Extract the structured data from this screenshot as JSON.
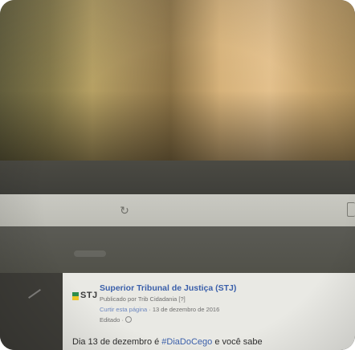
{
  "post": {
    "logo_text": "STJ",
    "page_name": "Superior Tribunal de Justiça (STJ)",
    "published_by": "Publicado por Trib Cidadania [?]",
    "like_link": "Curtir esta página",
    "date": " · 13 de dezembro de 2016",
    "edited": "Editado ·",
    "body_prefix": "Dia 13 de dezembro é ",
    "hashtag": "#DiaDoCego",
    "body_suffix": " e você sabe"
  },
  "icons": {
    "reload": "reload-icon",
    "share": "share-icon",
    "globe": "globe-icon"
  },
  "colors": {
    "link_blue": "#3a5faa",
    "flag_green": "#2f8f4e",
    "flag_yellow": "#f0c92a"
  }
}
